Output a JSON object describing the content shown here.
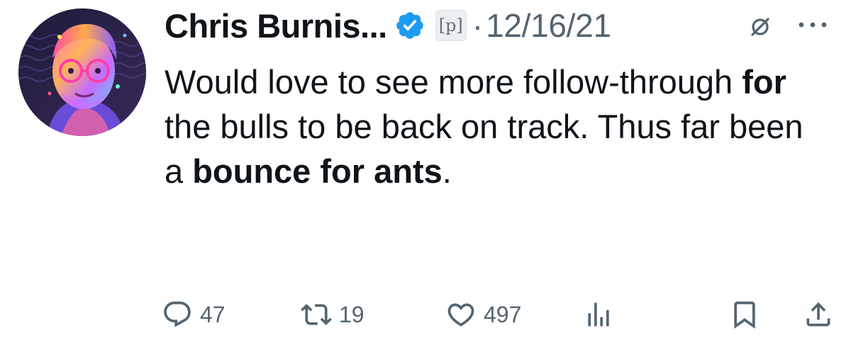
{
  "author": {
    "display_name": "Chris Burnis...",
    "badge_letter": "[p]",
    "separator": "·",
    "date": "12/16/21"
  },
  "tweet": {
    "segments": [
      {
        "text": "Would love to see more follow-through ",
        "bold": false
      },
      {
        "text": "for",
        "bold": true
      },
      {
        "text": " the bulls to be back on track. Thus far been a ",
        "bold": false
      },
      {
        "text": "bounce for ants",
        "bold": true
      },
      {
        "text": ".",
        "bold": false
      }
    ]
  },
  "actions": {
    "replies": "47",
    "retweets": "19",
    "likes": "497"
  },
  "colors": {
    "text": "#0f1419",
    "muted": "#536471",
    "verified": "#1d9bf0"
  },
  "icons": [
    "verified-badge-icon",
    "hidden-icon",
    "more-icon",
    "reply-icon",
    "retweet-icon",
    "like-icon",
    "views-icon",
    "bookmark-icon",
    "share-icon"
  ]
}
